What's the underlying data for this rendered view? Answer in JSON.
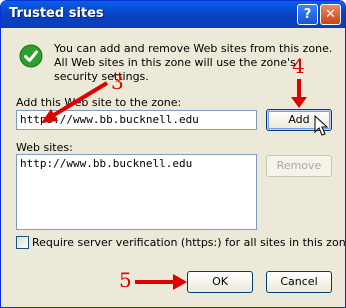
{
  "window": {
    "title": "Trusted sites",
    "help_glyph": "?",
    "close_glyph": "✕"
  },
  "info": {
    "icon": "check-icon",
    "text": "You can add and remove Web sites from this zone. All Web sites in this zone will use the zone's security settings."
  },
  "add_section": {
    "label": "Add this Web site to the zone:",
    "input_value": "https://www.bb.bucknell.edu",
    "add_button": "Add"
  },
  "sites_section": {
    "label": "Web sites:",
    "items": [
      "http://www.bb.bucknell.edu"
    ],
    "remove_button": "Remove"
  },
  "require_https": {
    "label": "Require server verification (https:) for all sites in this zone",
    "checked": false
  },
  "footer": {
    "ok_button": "OK",
    "cancel_button": "Cancel"
  },
  "annotations": {
    "step_3": "3",
    "step_4": "4",
    "step_5": "5",
    "color": "#e00000"
  },
  "colors": {
    "titlebar": "#0842c4",
    "dialog_bg": "#ece9d8",
    "check_green": "#2e9e2e"
  }
}
